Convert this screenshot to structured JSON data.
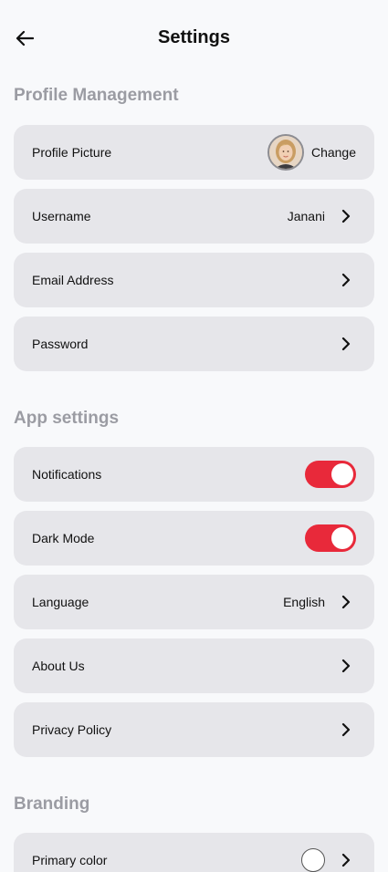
{
  "header": {
    "title": "Settings",
    "back_icon": "arrow-left-icon"
  },
  "profile_section": {
    "title": "Profile Management",
    "items": [
      {
        "label": "Profile Picture",
        "action": "Change"
      },
      {
        "label": "Username",
        "value": "Janani"
      },
      {
        "label": "Email Address"
      },
      {
        "label": "Password"
      }
    ]
  },
  "app_section": {
    "title": "App settings",
    "items": [
      {
        "label": "Notifications",
        "toggle_on": true
      },
      {
        "label": "Dark Mode",
        "toggle_on": true
      },
      {
        "label": "Language",
        "value": "English"
      },
      {
        "label": "About Us"
      },
      {
        "label": "Privacy Policy"
      }
    ]
  },
  "branding_section": {
    "title": "Branding",
    "items": [
      {
        "label": "Primary color",
        "swatch_color": "#ffffff"
      }
    ]
  },
  "colors": {
    "background": "#f8f9fb",
    "row_background": "#e6e6ea",
    "toggle_on": "#e8293a",
    "section_title": "#9b9ca3"
  }
}
